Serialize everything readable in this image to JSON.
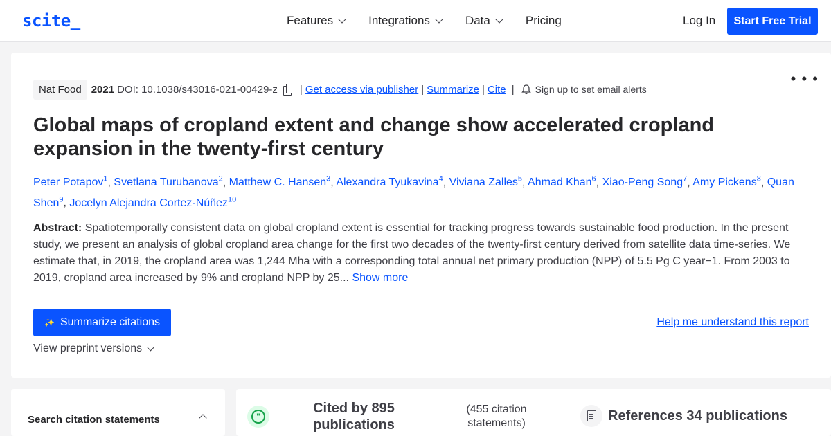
{
  "header": {
    "logo": "scite_",
    "nav": [
      "Features",
      "Integrations",
      "Data",
      "Pricing"
    ],
    "login": "Log In",
    "trial": "Start Free Trial"
  },
  "paper": {
    "journal": "Nat Food",
    "year": "2021",
    "doi": "DOI: 10.1038/s43016-021-00429-z",
    "links": [
      "Get access via publisher",
      "Summarize",
      "Cite"
    ],
    "alerts": "Sign up to set email alerts",
    "title": "Global maps of cropland extent and change show accelerated cropland expansion in the twenty-first century",
    "authors": [
      {
        "name": "Peter Potapov",
        "sup": "1"
      },
      {
        "name": "Svetlana Turubanova",
        "sup": "2"
      },
      {
        "name": "Matthew C. Hansen",
        "sup": "3"
      },
      {
        "name": "Alexandra Tyukavina",
        "sup": "4"
      },
      {
        "name": "Viviana Zalles",
        "sup": "5"
      },
      {
        "name": "Ahmad Khan",
        "sup": "6"
      },
      {
        "name": "Xiao-Peng Song",
        "sup": "7"
      },
      {
        "name": "Amy Pickens",
        "sup": "8"
      },
      {
        "name": "Quan Shen",
        "sup": "9"
      },
      {
        "name": "Jocelyn Alejandra Cortez-Núñez",
        "sup": "10"
      }
    ],
    "abstract_label": "Abstract:",
    "abstract": "Spatiotemporally consistent data on global cropland extent is essential for tracking progress towards sustainable food production. In the present study, we present an analysis of global cropland area change for the first two decades of the twenty-first century derived from satellite data time-series. We estimate that, in 2019, the cropland area was 1,244 Mha with a corresponding total annual net primary production (NPP) of 5.5 Pg C year−1. From 2003 to 2019, cropland area increased by 9% and cropland NPP by 25...",
    "show_more": "Show more",
    "summarize_citations": "Summarize citations",
    "help_link": "Help me understand this report",
    "preprint": "View preprint versions"
  },
  "bottom": {
    "search_title": "Search citation statements",
    "cited_by": "Cited by 895 publications",
    "statements": "(455 citation statements)",
    "references": "References 34 publications"
  },
  "colors": {
    "accent": "#0a54ff",
    "text": "#27272a",
    "background": "#f4f4f5"
  }
}
